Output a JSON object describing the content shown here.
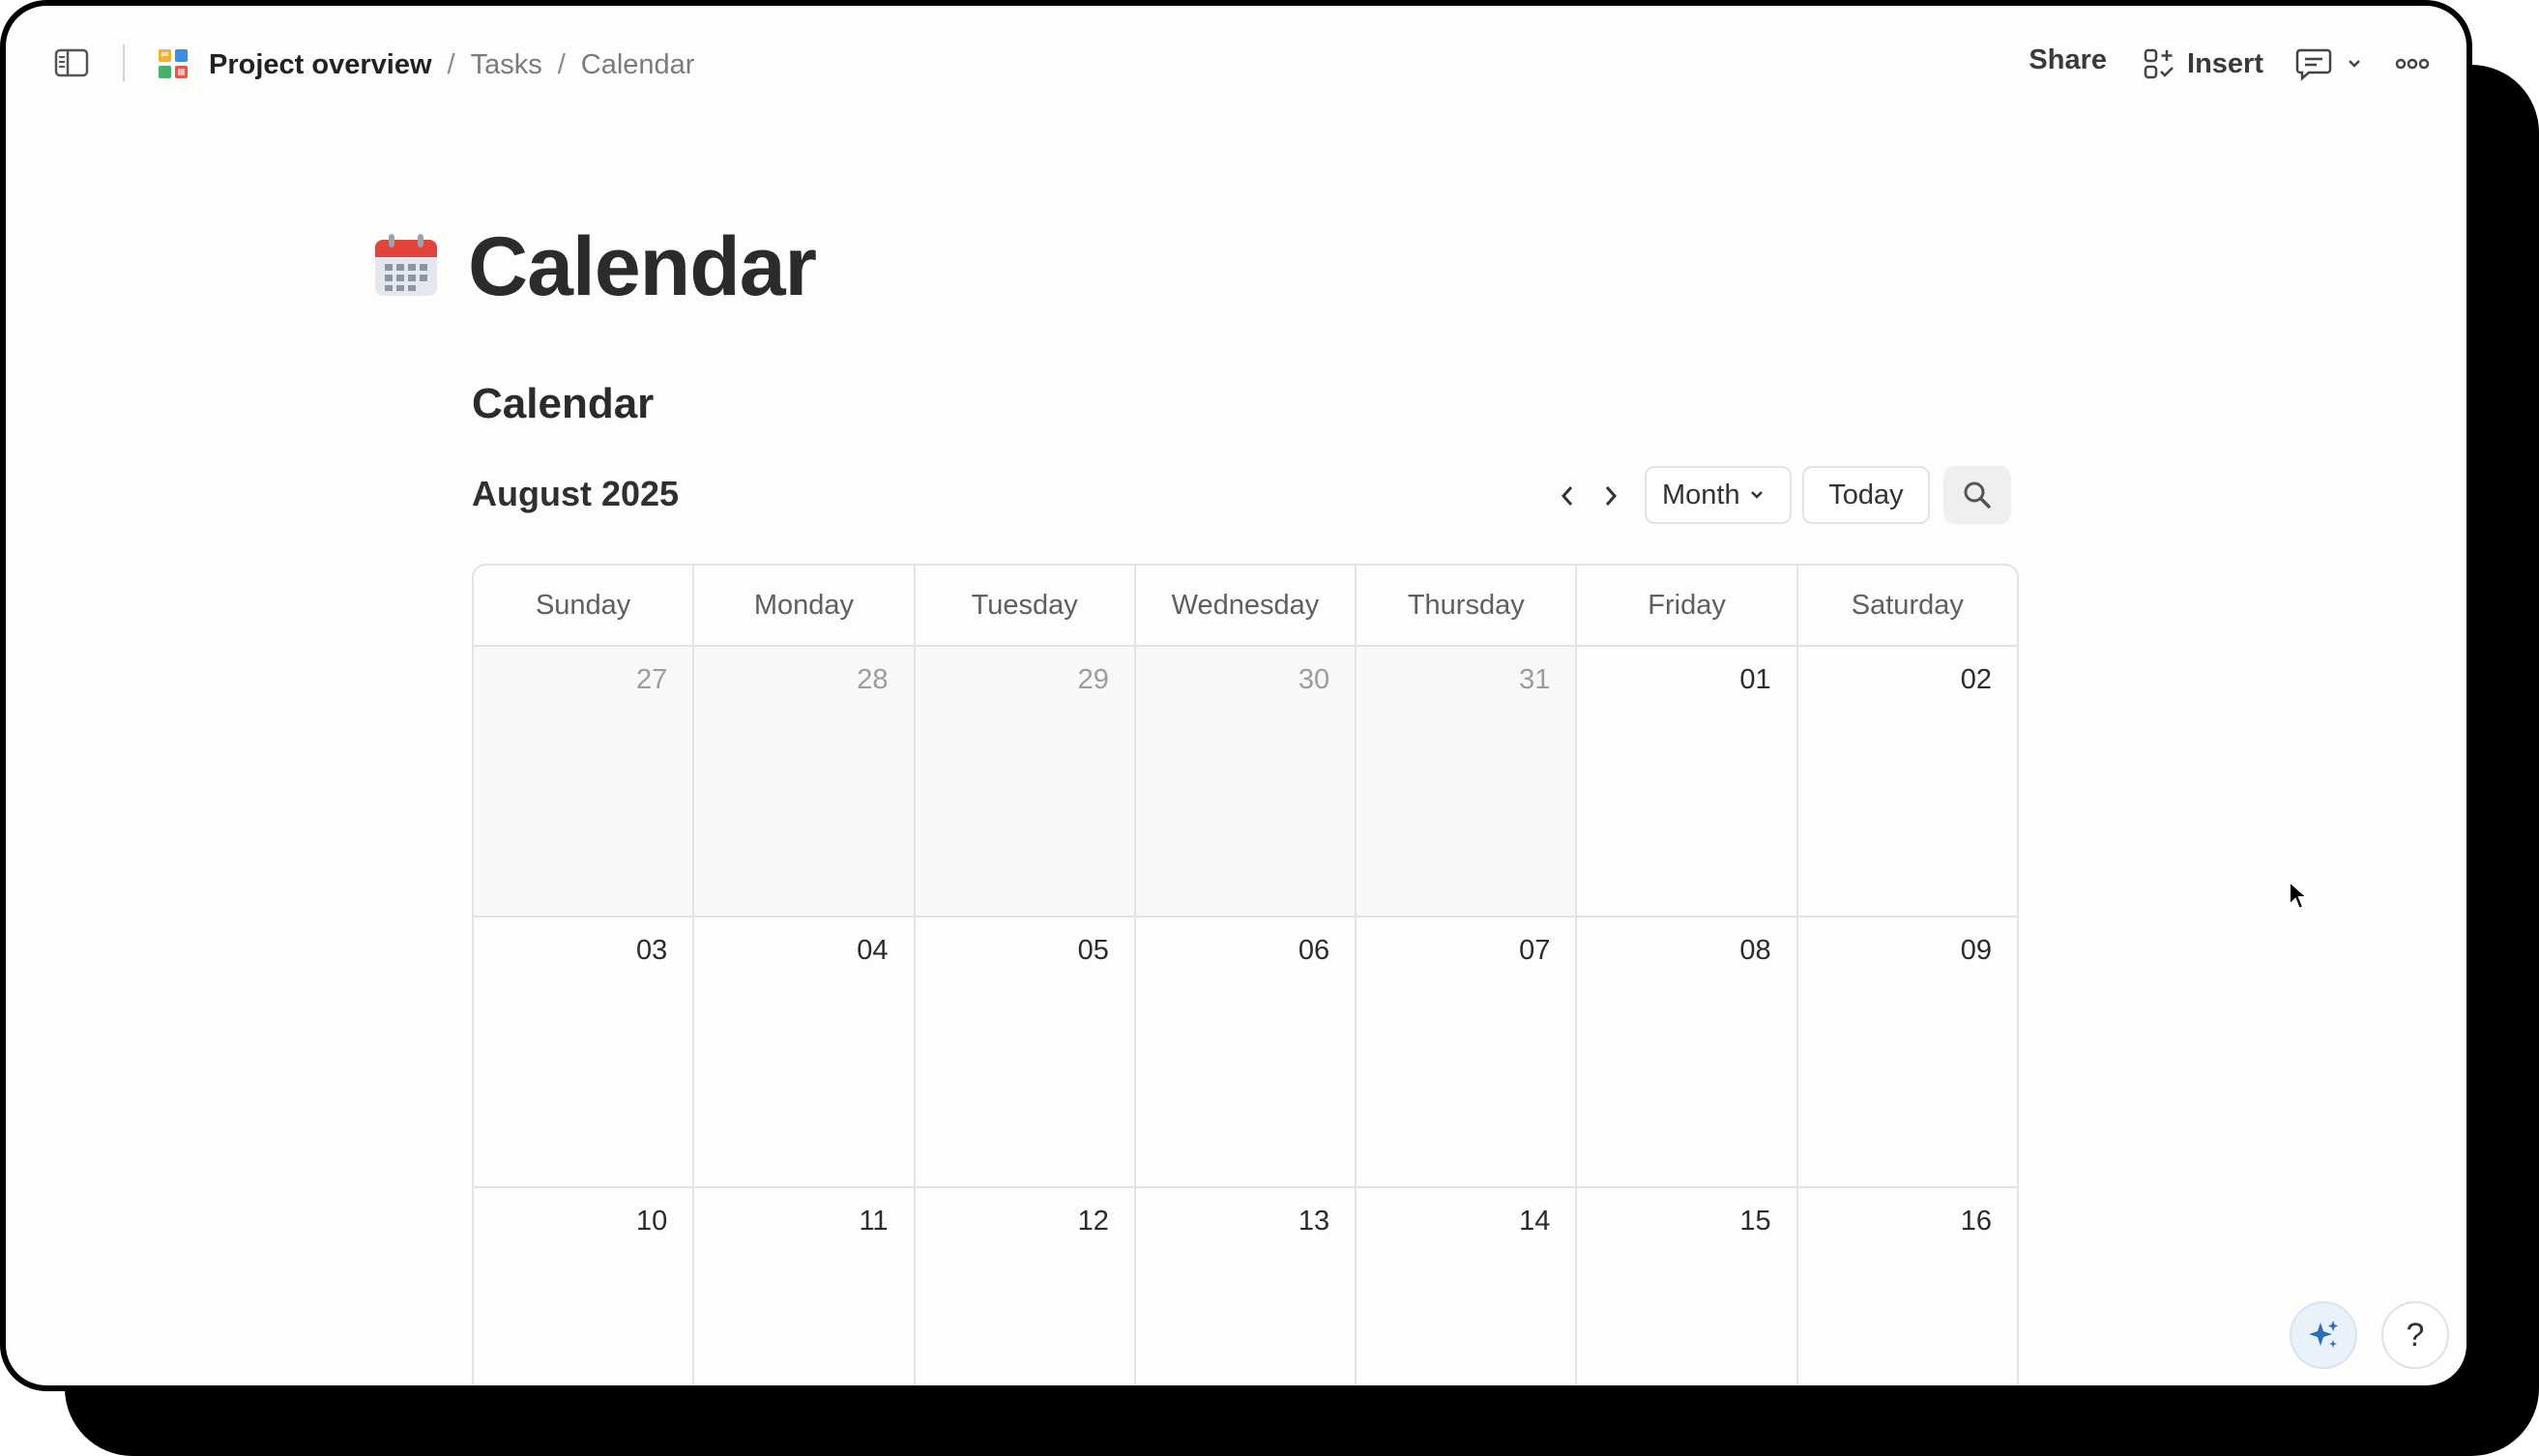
{
  "breadcrumb": {
    "project": "Project overview",
    "separator": "/",
    "tasks": "Tasks",
    "current": "Calendar"
  },
  "topbar": {
    "share_label": "Share",
    "insert_label": "Insert",
    "icons": [
      "sidebar-toggle-icon",
      "project-doc-icon",
      "insert-icon",
      "comment-icon",
      "chevron-down-icon",
      "more-icon"
    ]
  },
  "page": {
    "emoji": "calendar-emoji",
    "title": "Calendar"
  },
  "calendar": {
    "section_title": "Calendar",
    "month_label": "August 2025",
    "view_label": "Month",
    "today_label": "Today",
    "weekdays": [
      "Sunday",
      "Monday",
      "Tuesday",
      "Wednesday",
      "Thursday",
      "Friday",
      "Saturday"
    ],
    "weeks": [
      [
        {
          "day": "27",
          "outside": true
        },
        {
          "day": "28",
          "outside": true
        },
        {
          "day": "29",
          "outside": true
        },
        {
          "day": "30",
          "outside": true
        },
        {
          "day": "31",
          "outside": true
        },
        {
          "day": "01",
          "outside": false
        },
        {
          "day": "02",
          "outside": false
        }
      ],
      [
        {
          "day": "03",
          "outside": false
        },
        {
          "day": "04",
          "outside": false
        },
        {
          "day": "05",
          "outside": false
        },
        {
          "day": "06",
          "outside": false
        },
        {
          "day": "07",
          "outside": false
        },
        {
          "day": "08",
          "outside": false
        },
        {
          "day": "09",
          "outside": false
        }
      ],
      [
        {
          "day": "10",
          "outside": false
        },
        {
          "day": "11",
          "outside": false
        },
        {
          "day": "12",
          "outside": false
        },
        {
          "day": "13",
          "outside": false
        },
        {
          "day": "14",
          "outside": false
        },
        {
          "day": "15",
          "outside": false
        },
        {
          "day": "16",
          "outside": false
        }
      ]
    ]
  },
  "floating": {
    "help_label": "?"
  },
  "colors": {
    "background": "#fdfdfc",
    "outside_day_bg": "#f7f8fa",
    "border": "#e4e4e2",
    "text": "#2b2b2b",
    "muted_text": "#9c9c9a",
    "ai_accent": "#2a6fb8"
  }
}
